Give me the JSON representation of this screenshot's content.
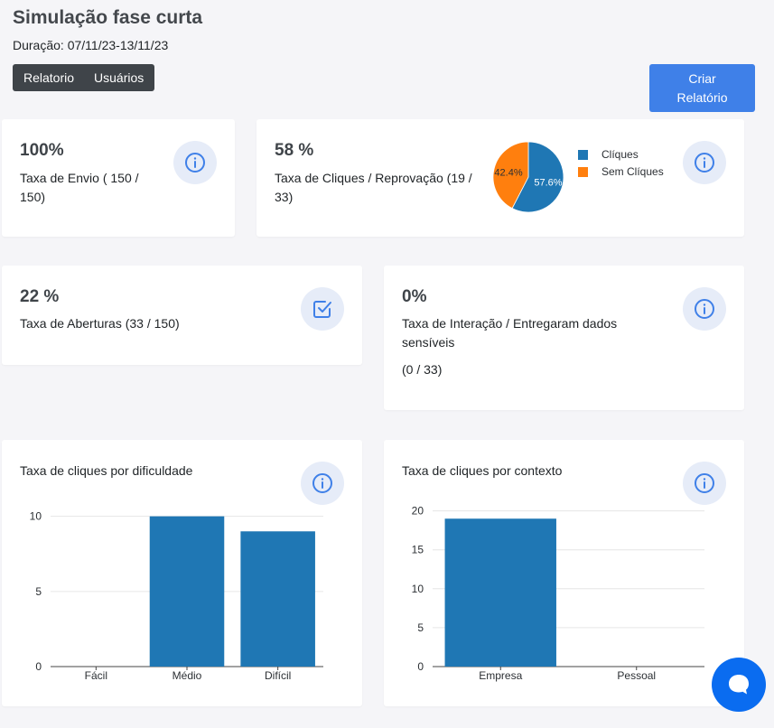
{
  "header": {
    "title": "Simulação fase curta",
    "duration": "Duração: 07/11/23-13/11/23"
  },
  "tabs": [
    {
      "label": "Relatorio"
    },
    {
      "label": "Usuários"
    }
  ],
  "create_button": {
    "line1": "Criar",
    "line2": "Relatório"
  },
  "cards": {
    "envio": {
      "value": "100%",
      "label_line1": "Taxa de Envio ( 150 /",
      "label_line2": "150)"
    },
    "cliques": {
      "value": "58 %",
      "label_line1": "Taxa de Cliques / Reprovação (19 /",
      "label_line2": "33)"
    },
    "aberturas": {
      "value": "22 %",
      "label": "Taxa de Aberturas (33 / 150)"
    },
    "interacao": {
      "value": "0%",
      "label_line1": "Taxa de Interação / Entregaram dados",
      "label_line2": "sensíveis",
      "label_line3": "(0 / 33)"
    }
  },
  "icons": {
    "info": "info-icon",
    "check": "checkbox-icon",
    "chat": "chat-icon"
  },
  "colors": {
    "blue": "#1f77b4",
    "orange": "#ff7f0e",
    "accent": "#3f80e8",
    "chat": "#0a6cf0"
  },
  "chart_data": [
    {
      "type": "pie",
      "labels": [
        "Clíques",
        "Sem Clíques"
      ],
      "values": [
        57.6,
        42.4
      ],
      "data_labels": [
        "57.6%",
        "42.4%"
      ],
      "colors": [
        "#1f77b4",
        "#ff7f0e"
      ],
      "legend": "right"
    },
    {
      "type": "bar",
      "title": "Taxa de cliques por dificuldade",
      "categories": [
        "Fácil",
        "Médio",
        "Difícil"
      ],
      "values": [
        0,
        10,
        9
      ],
      "ylim": [
        0,
        11
      ],
      "yticks": [
        "0",
        "5",
        "10"
      ],
      "grid": true
    },
    {
      "type": "bar",
      "title": "Taxa de cliques por contexto",
      "categories": [
        "Empresa",
        "Pessoal"
      ],
      "values": [
        19,
        0
      ],
      "ylim": [
        0,
        21
      ],
      "yticks": [
        "0",
        "5",
        "10",
        "15",
        "20"
      ],
      "grid": true
    }
  ]
}
